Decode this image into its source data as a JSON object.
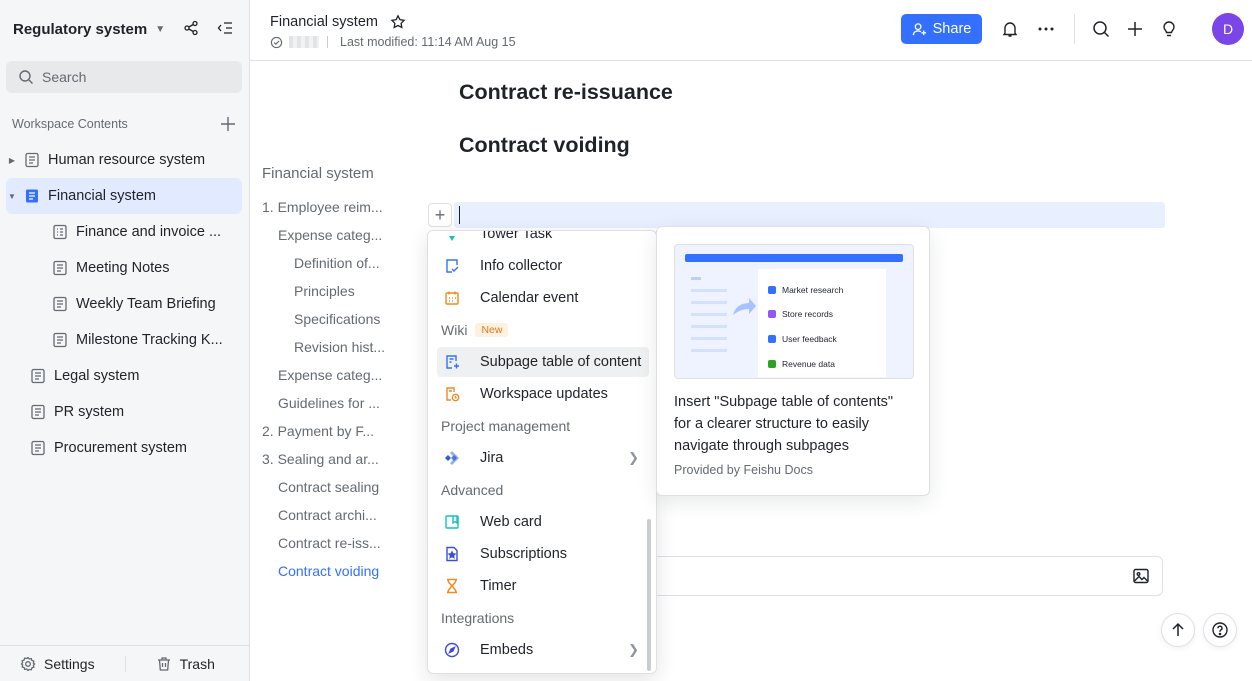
{
  "sidebar": {
    "workspace_title": "Regulatory system",
    "search_placeholder": "Search",
    "contents_label": "Workspace Contents",
    "items": [
      {
        "label": "Human resource system"
      },
      {
        "label": "Financial system"
      },
      {
        "label": "Finance and invoice ..."
      },
      {
        "label": "Meeting Notes"
      },
      {
        "label": "Weekly Team Briefing"
      },
      {
        "label": "Milestone Tracking K..."
      },
      {
        "label": "Legal system"
      },
      {
        "label": "PR system"
      },
      {
        "label": "Procurement system"
      }
    ],
    "footer": {
      "settings": "Settings",
      "trash": "Trash"
    }
  },
  "header": {
    "doc_title": "Financial system",
    "last_modified": "Last modified: 11:14 AM Aug 15",
    "share_label": "Share",
    "avatar_initial": "D"
  },
  "toc": {
    "title": "Financial system",
    "items": [
      {
        "label": "1. Employee reim..."
      },
      {
        "label": "Expense categ..."
      },
      {
        "label": "Definition of..."
      },
      {
        "label": "Principles"
      },
      {
        "label": "Specifications"
      },
      {
        "label": "Revision hist..."
      },
      {
        "label": "Expense categ..."
      },
      {
        "label": "Guidelines for ..."
      },
      {
        "label": "2. Payment by F..."
      },
      {
        "label": "3. Sealing and ar..."
      },
      {
        "label": "Contract sealing"
      },
      {
        "label": "Contract archi..."
      },
      {
        "label": "Contract re-iss..."
      },
      {
        "label": "Contract voiding"
      }
    ]
  },
  "document": {
    "heading_1": "Contract re-issuance",
    "heading_2": "Contract voiding"
  },
  "menu": {
    "partial_item": "Tower Task",
    "items": {
      "info_collector": "Info collector",
      "calendar_event": "Calendar event",
      "subpage_toc": "Subpage table of content",
      "workspace_updates": "Workspace updates",
      "jira": "Jira",
      "web_card": "Web card",
      "subscriptions": "Subscriptions",
      "timer": "Timer",
      "embeds": "Embeds"
    },
    "groups": {
      "wiki": "Wiki",
      "wiki_badge": "New",
      "project_management": "Project management",
      "advanced": "Advanced",
      "integrations": "Integrations"
    }
  },
  "preview": {
    "rows": [
      "Market research",
      "Store records",
      "User feedback",
      "Revenue data"
    ],
    "description": "Insert \"Subpage table of contents\" for a clearer structure to easily navigate through subpages",
    "source": "Provided by Feishu Docs"
  },
  "colors": {
    "accent": "#3370ff",
    "active_bg": "#e1eaff",
    "avatar": "#7b45e8",
    "badge_text": "#e0761f"
  }
}
